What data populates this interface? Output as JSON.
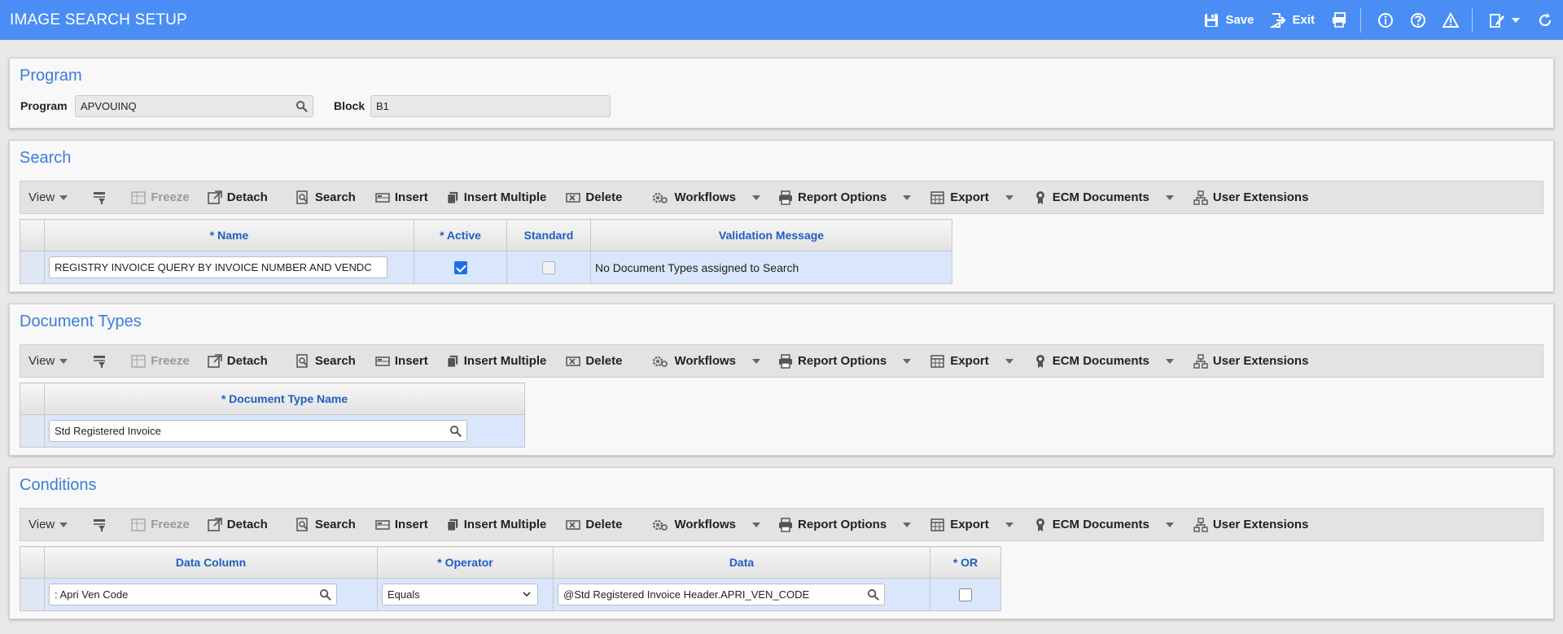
{
  "app": {
    "title": "IMAGE SEARCH SETUP",
    "save_label": "Save",
    "exit_label": "Exit"
  },
  "program_panel": {
    "title": "Program",
    "program_label": "Program",
    "program_value": "APVOUINQ",
    "block_label": "Block",
    "block_value": "B1"
  },
  "toolbar": {
    "view": "View",
    "freeze": "Freeze",
    "detach": "Detach",
    "search": "Search",
    "insert": "Insert",
    "insert_multiple": "Insert Multiple",
    "delete": "Delete",
    "workflows": "Workflows",
    "report_options": "Report Options",
    "export": "Export",
    "ecm_documents": "ECM Documents",
    "user_extensions": "User Extensions"
  },
  "search_panel": {
    "title": "Search",
    "columns": [
      "* Name",
      "* Active",
      "Standard",
      "Validation Message"
    ],
    "row": {
      "name": "REGISTRY INVOICE QUERY BY INVOICE NUMBER AND VENDC",
      "active": true,
      "standard": false,
      "validation_message": "No Document Types assigned to Search"
    }
  },
  "doctype_panel": {
    "title": "Document Types",
    "columns": [
      "* Document Type Name"
    ],
    "row": {
      "document_type_name": "Std Registered Invoice"
    }
  },
  "conditions_panel": {
    "title": "Conditions",
    "columns": [
      "Data Column",
      "* Operator",
      "Data",
      "* OR"
    ],
    "row": {
      "data_column": ": Apri Ven Code",
      "operator": "Equals",
      "data": "@Std Registered Invoice Header.APRI_VEN_CODE",
      "or": false
    }
  },
  "colors": {
    "titlebar": "#4a8ef5",
    "panel_title": "#3a7de0",
    "header_text": "#1f5fc2",
    "row_bg": "#d9e6fb"
  }
}
